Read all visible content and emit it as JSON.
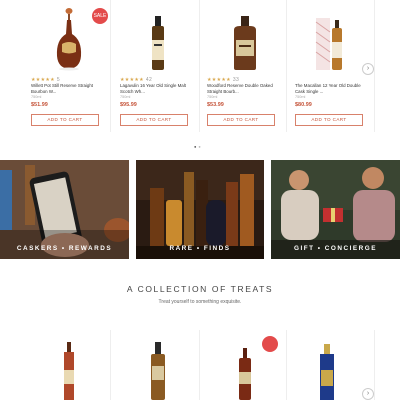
{
  "products_top": [
    {
      "name": "Willett Pot Still Reserve Straight Bourbon W...",
      "size": "750ml",
      "price": "$51.99",
      "reviews": "5",
      "badge": "SALE"
    },
    {
      "name": "Lagavulin 16 Year Old Single Malt Scotch Wh...",
      "size": "750ml",
      "price": "$95.99",
      "reviews": "42",
      "badge": ""
    },
    {
      "name": "Woodford Reserve Double Oaked Straight Bourb...",
      "size": "750ml",
      "price": "$53.99",
      "reviews": "33",
      "badge": ""
    },
    {
      "name": "The Macallan 12 Year Old Double Cask Single ...",
      "size": "750ml",
      "price": "$80.99",
      "reviews": "",
      "badge": ""
    }
  ],
  "add_to_cart_label": "ADD TO CART",
  "stars": "★★★★★",
  "promos": [
    {
      "label": "CASKERS • REWARDS"
    },
    {
      "label": "RARE • FINDS"
    },
    {
      "label": "GIFT • CONCIERGE"
    }
  ],
  "collection": {
    "title": "A COLLECTION OF TREATS",
    "subtitle": "Treat yourself to something exquisite."
  },
  "arrow_glyph": "›",
  "colors": {
    "accent": "#c5543a",
    "badge": "#e34b4b",
    "star": "#d9a84e"
  }
}
